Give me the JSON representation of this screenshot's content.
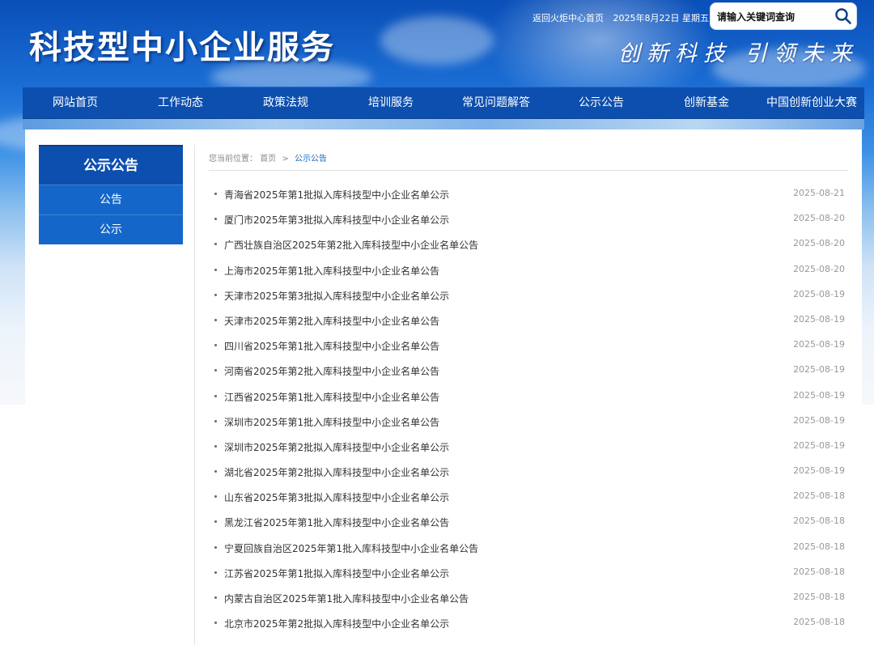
{
  "header": {
    "site_title": "科技型中小企业服务",
    "slogan": "创新科技 引领未来",
    "top_links": [
      "返回火炬中心首页",
      "2025年8月22日 星期五"
    ],
    "search": {
      "placeholder": "请输入关键词查询",
      "icon": "search-icon"
    }
  },
  "nav": {
    "items": [
      "网站首页",
      "工作动态",
      "政策法规",
      "培训服务",
      "常见问题解答",
      "公示公告",
      "创新基金",
      "中国创新创业大赛"
    ]
  },
  "sidebar": {
    "title": "公示公告",
    "items": [
      "公告",
      "公示"
    ]
  },
  "breadcrumb": {
    "label": "您当前位置：",
    "home": "首页",
    "separator": ">",
    "current": "公示公告"
  },
  "articles": [
    {
      "title": "青海省2025年第1批拟入库科技型中小企业名单公示",
      "date": "2025-08-21"
    },
    {
      "title": "厦门市2025年第3批拟入库科技型中小企业名单公示",
      "date": "2025-08-20"
    },
    {
      "title": "广西壮族自治区2025年第2批入库科技型中小企业名单公告",
      "date": "2025-08-20"
    },
    {
      "title": "上海市2025年第1批入库科技型中小企业名单公告",
      "date": "2025-08-20"
    },
    {
      "title": "天津市2025年第3批拟入库科技型中小企业名单公示",
      "date": "2025-08-19"
    },
    {
      "title": "天津市2025年第2批入库科技型中小企业名单公告",
      "date": "2025-08-19"
    },
    {
      "title": "四川省2025年第1批入库科技型中小企业名单公告",
      "date": "2025-08-19"
    },
    {
      "title": "河南省2025年第2批入库科技型中小企业名单公告",
      "date": "2025-08-19"
    },
    {
      "title": "江西省2025年第1批入库科技型中小企业名单公告",
      "date": "2025-08-19"
    },
    {
      "title": "深圳市2025年第1批入库科技型中小企业名单公告",
      "date": "2025-08-19"
    },
    {
      "title": "深圳市2025年第2批拟入库科技型中小企业名单公示",
      "date": "2025-08-19"
    },
    {
      "title": "湖北省2025年第2批拟入库科技型中小企业名单公示",
      "date": "2025-08-19"
    },
    {
      "title": "山东省2025年第3批拟入库科技型中小企业名单公示",
      "date": "2025-08-18"
    },
    {
      "title": "黑龙江省2025年第1批入库科技型中小企业名单公告",
      "date": "2025-08-18"
    },
    {
      "title": "宁夏回族自治区2025年第1批入库科技型中小企业名单公告",
      "date": "2025-08-18"
    },
    {
      "title": "江苏省2025年第1批拟入库科技型中小企业名单公示",
      "date": "2025-08-18"
    },
    {
      "title": "内蒙古自治区2025年第1批入库科技型中小企业名单公告",
      "date": "2025-08-18"
    },
    {
      "title": "北京市2025年第2批拟入库科技型中小企业名单公示",
      "date": "2025-08-18"
    }
  ],
  "colors": {
    "nav_bg": "#0d4fae",
    "sidebar_item_bg": "#1467c8",
    "link_active": "#1467c8"
  }
}
